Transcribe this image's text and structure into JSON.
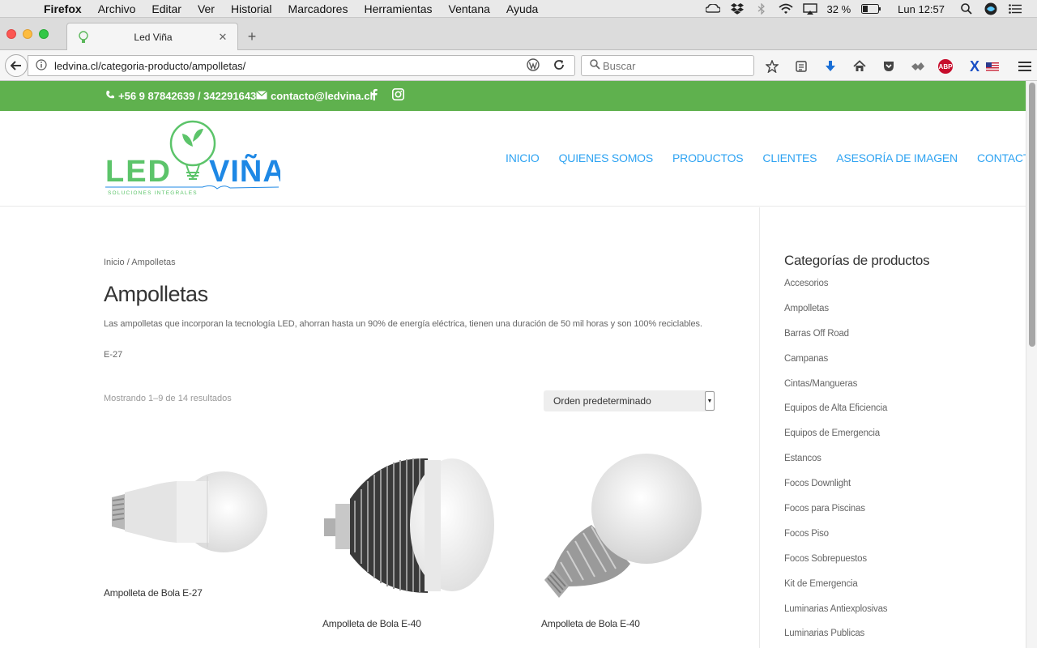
{
  "os_menubar": {
    "app": "Firefox",
    "items": [
      "Archivo",
      "Editar",
      "Ver",
      "Historial",
      "Marcadores",
      "Herramientas",
      "Ventana",
      "Ayuda"
    ],
    "battery": "32 %",
    "clock": "Lun 12:57",
    "status_icons": [
      "creative-cloud-icon",
      "dropbox-icon",
      "bluetooth-icon",
      "wifi-icon",
      "airplay-icon",
      "battery-icon",
      "spotlight-icon",
      "siri-icon",
      "notification-center-icon"
    ]
  },
  "browser": {
    "tab_title": "Led Viña",
    "url": "ledvina.cl/categoria-producto/ampolletas/",
    "search_placeholder": "Buscar",
    "toolbar_icons": [
      "bookmark-star-icon",
      "reading-list-icon",
      "download-icon",
      "home-icon",
      "pocket-icon",
      "extension-icon",
      "adblock-icon",
      "x-extension-icon",
      "flag-icon",
      "menu-icon"
    ],
    "adblock_label": "ABP"
  },
  "site": {
    "topbar": {
      "phone": "+56 9 87842639 / 342291643",
      "email": "contacto@ledvina.cl"
    },
    "logo": {
      "word1": "LED",
      "word2": "VIÑA",
      "tagline": "SOLUCIONES INTEGRALES"
    },
    "nav": [
      "INICIO",
      "QUIENES SOMOS",
      "PRODUCTOS",
      "CLIENTES",
      "ASESORÍA DE IMAGEN",
      "CONTACTO"
    ],
    "breadcrumb": "Inicio / Ampolletas",
    "page_title": "Ampolletas",
    "description": "Las ampolletas que incorporan la tecnología LED, ahorran hasta un 90% de energía eléctrica, tienen una duración de 50 mil horas y son 100% reciclables.",
    "subtext": "E-27",
    "result_count": "Mostrando 1–9 de 14 resultados",
    "order_select": "Orden predeterminado",
    "products": [
      {
        "name": "Ampolleta de Bola E-27"
      },
      {
        "name": "Ampolleta de Bola E-40"
      },
      {
        "name": "Ampolleta de Bola E-40"
      }
    ],
    "sidebar": {
      "title": "Categorías de productos",
      "categories": [
        "Accesorios",
        "Ampolletas",
        "Barras Off Road",
        "Campanas",
        "Cintas/Mangueras",
        "Equipos de Alta Eficiencia",
        "Equipos de Emergencia",
        "Estancos",
        "Focos Downlight",
        "Focos para Piscinas",
        "Focos Piso",
        "Focos Sobrepuestos",
        "Kit de Emergencia",
        "Luminarias Antiexplosivas",
        "Luminarias Publicas"
      ]
    },
    "colors": {
      "topbar_green": "#5fb14e",
      "nav_blue": "#2ea3f2",
      "logo_green": "#5cc46a",
      "logo_blue": "#1e88e5"
    }
  }
}
